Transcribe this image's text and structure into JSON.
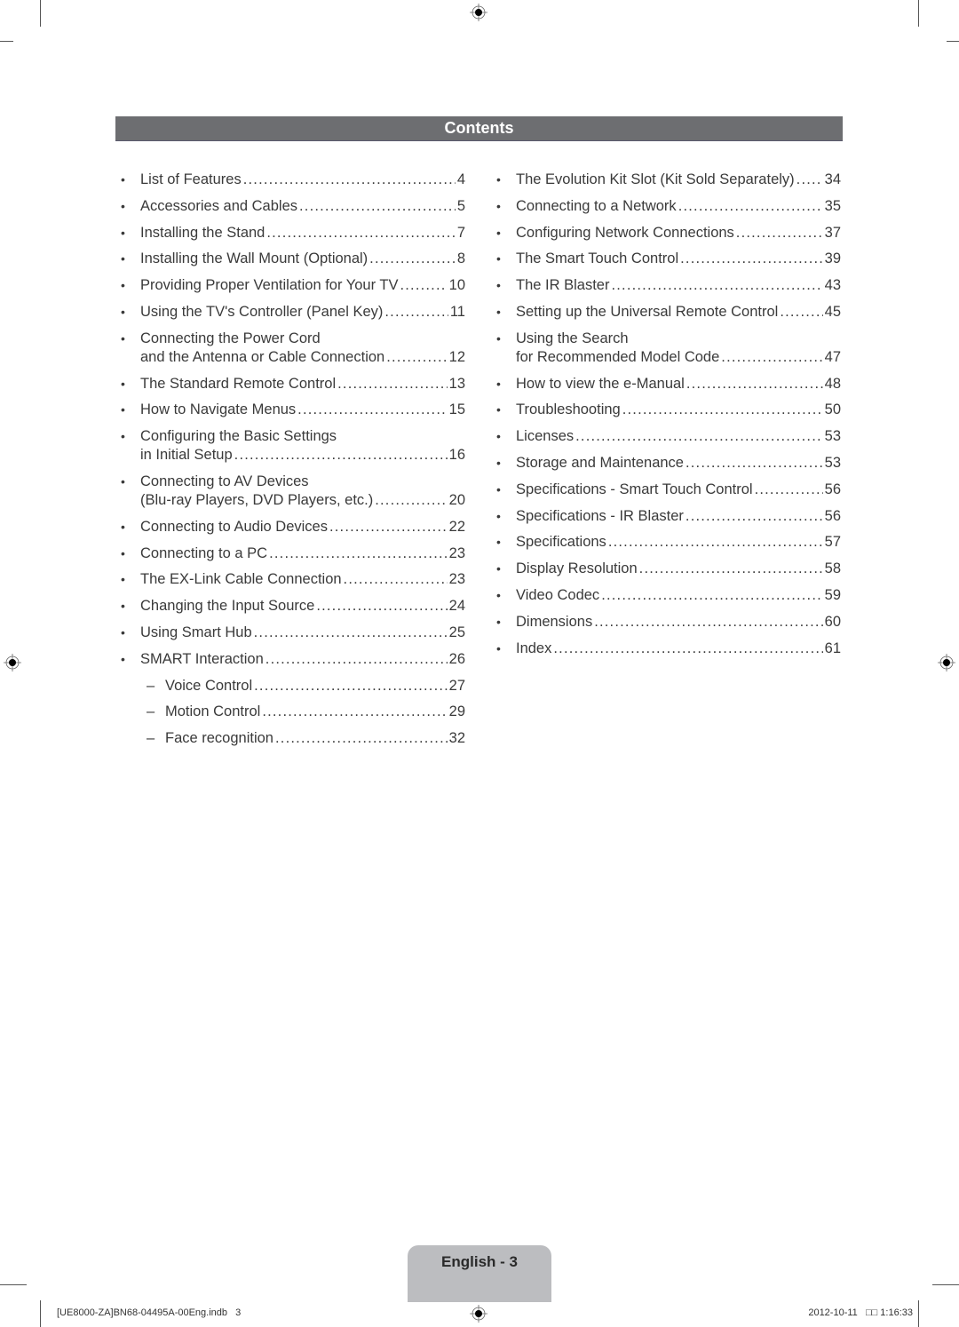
{
  "header": {
    "title": "Contents"
  },
  "left_column": [
    {
      "type": "bullet",
      "lines": [
        "List of Features"
      ],
      "page": "4"
    },
    {
      "type": "bullet",
      "lines": [
        "Accessories and Cables"
      ],
      "page": "5"
    },
    {
      "type": "bullet",
      "lines": [
        "Installing the Stand"
      ],
      "page": "7"
    },
    {
      "type": "bullet",
      "lines": [
        "Installing the Wall Mount (Optional)"
      ],
      "page": "8"
    },
    {
      "type": "bullet",
      "lines": [
        "Providing Proper Ventilation for Your TV"
      ],
      "page": "10"
    },
    {
      "type": "bullet",
      "lines": [
        "Using the TV's Controller (Panel Key)"
      ],
      "page": "11"
    },
    {
      "type": "bullet",
      "lines": [
        "Connecting the Power Cord",
        "and the Antenna or Cable Connection"
      ],
      "page": "12"
    },
    {
      "type": "bullet",
      "lines": [
        "The Standard Remote Control"
      ],
      "page": "13"
    },
    {
      "type": "bullet",
      "lines": [
        "How to Navigate Menus"
      ],
      "page": "15"
    },
    {
      "type": "bullet",
      "lines": [
        "Configuring the Basic Settings",
        "in Initial Setup"
      ],
      "page": "16"
    },
    {
      "type": "bullet",
      "lines": [
        "Connecting to AV Devices",
        "(Blu-ray Players, DVD Players, etc.)"
      ],
      "page": "20"
    },
    {
      "type": "bullet",
      "lines": [
        "Connecting to Audio Devices"
      ],
      "page": "22"
    },
    {
      "type": "bullet",
      "lines": [
        "Connecting to a PC"
      ],
      "page": "23"
    },
    {
      "type": "bullet",
      "lines": [
        "The EX-Link Cable Connection"
      ],
      "page": "23"
    },
    {
      "type": "bullet",
      "lines": [
        "Changing the Input Source"
      ],
      "page": "24"
    },
    {
      "type": "bullet",
      "lines": [
        "Using Smart Hub"
      ],
      "page": "25"
    },
    {
      "type": "bullet",
      "lines": [
        "SMART Interaction"
      ],
      "page": "26"
    },
    {
      "type": "sub",
      "lines": [
        "Voice Control"
      ],
      "page": "27"
    },
    {
      "type": "sub",
      "lines": [
        "Motion Control"
      ],
      "page": "29"
    },
    {
      "type": "sub",
      "lines": [
        "Face recognition"
      ],
      "page": "32"
    }
  ],
  "right_column": [
    {
      "type": "bullet",
      "lines": [
        "The Evolution Kit Slot (Kit Sold Separately)"
      ],
      "page": "34"
    },
    {
      "type": "bullet",
      "lines": [
        "Connecting to a Network"
      ],
      "page": "35"
    },
    {
      "type": "bullet",
      "lines": [
        "Configuring Network Connections"
      ],
      "page": "37"
    },
    {
      "type": "bullet",
      "lines": [
        "The Smart Touch Control"
      ],
      "page": "39"
    },
    {
      "type": "bullet",
      "lines": [
        "The IR Blaster"
      ],
      "page": "43"
    },
    {
      "type": "bullet",
      "lines": [
        "Setting up the Universal Remote Control"
      ],
      "page": "45"
    },
    {
      "type": "bullet",
      "lines": [
        "Using the Search",
        "for Recommended Model Code"
      ],
      "page": "47"
    },
    {
      "type": "bullet",
      "lines": [
        "How to view the e-Manual"
      ],
      "page": "48"
    },
    {
      "type": "bullet",
      "lines": [
        "Troubleshooting"
      ],
      "page": "50"
    },
    {
      "type": "bullet",
      "lines": [
        "Licenses"
      ],
      "page": "53"
    },
    {
      "type": "bullet",
      "lines": [
        "Storage and Maintenance"
      ],
      "page": "53"
    },
    {
      "type": "bullet",
      "lines": [
        "Specifications - Smart Touch Control"
      ],
      "page": "56"
    },
    {
      "type": "bullet",
      "lines": [
        "Specifications - IR Blaster"
      ],
      "page": "56"
    },
    {
      "type": "bullet",
      "lines": [
        "Specifications"
      ],
      "page": "57"
    },
    {
      "type": "bullet",
      "lines": [
        "Display Resolution"
      ],
      "page": "58"
    },
    {
      "type": "bullet",
      "lines": [
        "Video Codec"
      ],
      "page": "59"
    },
    {
      "type": "bullet",
      "lines": [
        "Dimensions"
      ],
      "page": "60"
    },
    {
      "type": "bullet",
      "lines": [
        "Index"
      ],
      "page": "61"
    }
  ],
  "symbols": {
    "bullet": "•",
    "dash": "–"
  },
  "footer": {
    "page_tab": "English - 3",
    "file_info": "[UE8000-ZA]BN68-04495A-00Eng.indb   3",
    "timestamp": "2012-10-11   □□ 1:16:33"
  },
  "colors": {
    "header_bar": "#6d6e71",
    "page_tab": "#bcbdc0",
    "text": "#3a3a3a"
  }
}
